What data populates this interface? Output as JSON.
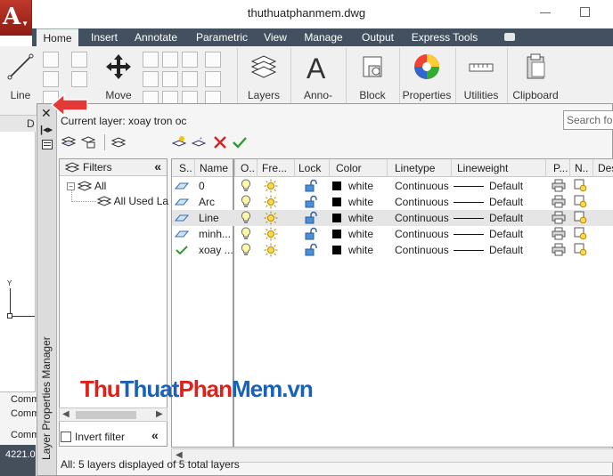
{
  "title": "thuthuatphanmem.dwg",
  "ribbon": {
    "tabs": [
      "Home",
      "Insert",
      "Annotate",
      "Parametric",
      "View",
      "Manage",
      "Output",
      "Express Tools"
    ],
    "active_tab": "Home",
    "buttons": {
      "line": "Line",
      "move": "Move",
      "layers": "Layers",
      "annotation": "Anno-tation",
      "block": "Block",
      "properties": "Properties",
      "utilities": "Utilities",
      "clipboard": "Clipboard"
    },
    "panel_label_fragment": "D"
  },
  "palette": {
    "title": "Layer Properties Manager",
    "current_layer": "Current layer: xoay tron oc",
    "search_placeholder": "Search for",
    "filters_header": "Filters",
    "filter_tree": [
      "All",
      "All Used La"
    ],
    "invert_filter": "Invert filter",
    "columns": [
      "S..",
      "Name",
      "O..",
      "Fre...",
      "Lock",
      "Color",
      "Linetype",
      "Lineweight",
      "P...",
      "N..",
      "Des"
    ],
    "layers": [
      {
        "name": "0",
        "color": "white",
        "linetype": "Continuous",
        "lineweight": "Default",
        "current": false
      },
      {
        "name": "Arc",
        "color": "white",
        "linetype": "Continuous",
        "lineweight": "Default",
        "current": false
      },
      {
        "name": "Line",
        "color": "white",
        "linetype": "Continuous",
        "lineweight": "Default",
        "current": false
      },
      {
        "name": "minh...",
        "color": "white",
        "linetype": "Continuous",
        "lineweight": "Default",
        "current": false
      },
      {
        "name": "xoay ...",
        "color": "white",
        "linetype": "Continuous",
        "lineweight": "Default",
        "current": true
      }
    ],
    "selected_layer": "Line",
    "status": "All: 5 layers displayed of 5 total layers"
  },
  "drawing": {
    "axis_label": "Y",
    "command_lines": [
      "Comm",
      "Comm",
      "Comm"
    ],
    "coordinates": "4221.0"
  },
  "watermark": {
    "part1": "Thu",
    "part2": "Thuat",
    "part3": "Phan",
    "part4": "Mem.vn"
  },
  "colors": {
    "tab_bar": "#42505f",
    "app_button": "#c0392b",
    "watermark_red": "#e0201b",
    "watermark_blue": "#1a62b8",
    "current_check": "#2e9b2e"
  }
}
